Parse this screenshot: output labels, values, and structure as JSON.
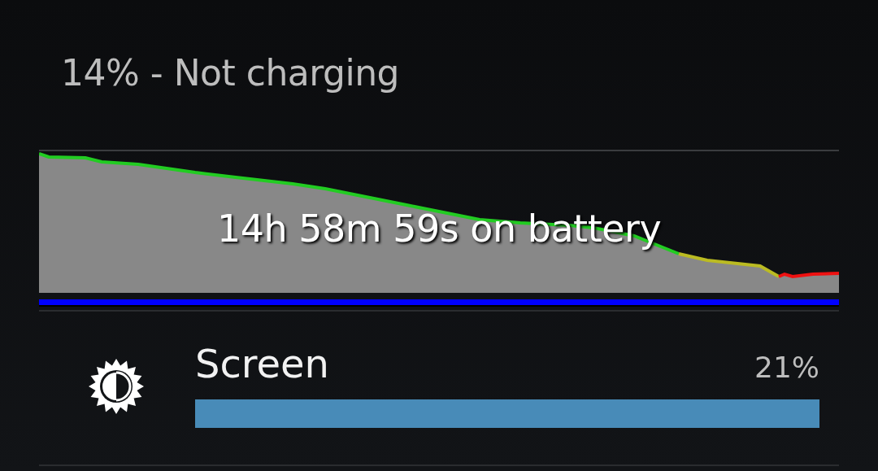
{
  "status": {
    "title": "14% - Not charging"
  },
  "history": {
    "duration": "14h 58m 59s on battery"
  },
  "usage": [
    {
      "name": "Screen",
      "percent": "21%"
    }
  ]
}
